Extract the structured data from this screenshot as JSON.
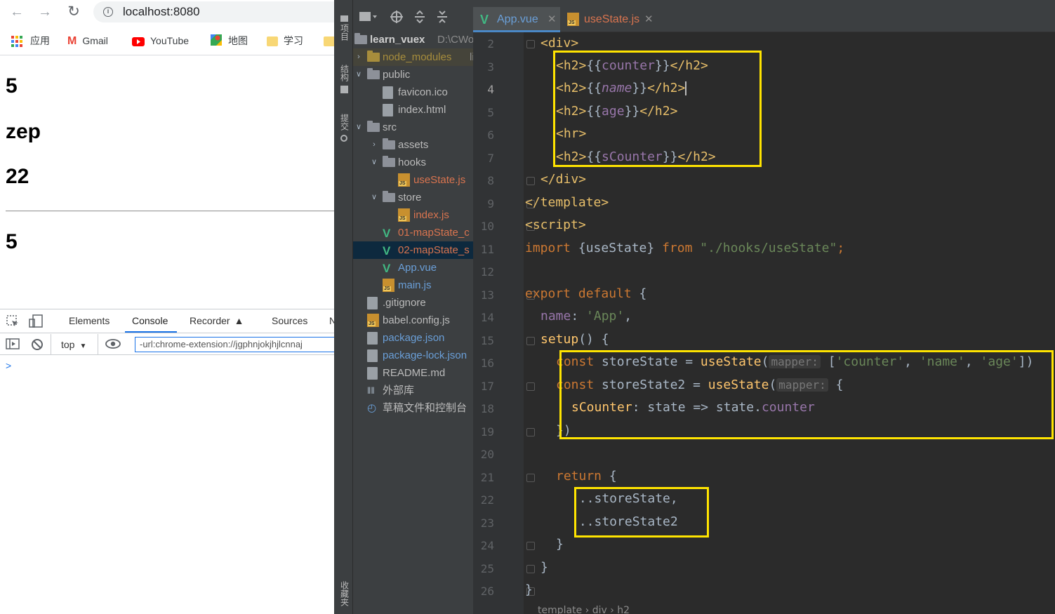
{
  "browser": {
    "url": "localhost:8080",
    "bookmarks": [
      {
        "label": "应用",
        "icon": "apps-grid-icon"
      },
      {
        "label": "Gmail",
        "icon": "gmail-icon"
      },
      {
        "label": "YouTube",
        "icon": "youtube-icon"
      },
      {
        "label": "地图",
        "icon": "maps-icon"
      },
      {
        "label": "学习",
        "icon": "folder-icon"
      }
    ],
    "page": {
      "counter": "5",
      "name": "zep",
      "age": "22",
      "sCounter": "5"
    },
    "devtools": {
      "tabs": [
        "Elements",
        "Console",
        "Recorder",
        "Sources",
        "N"
      ],
      "active_tab": "Console",
      "context": "top",
      "filter_value": "-url:chrome-extension://jgphnjokjhjlcnnaj",
      "prompt": ">"
    }
  },
  "ide": {
    "side_tool_labels": [
      "项目",
      "结构",
      "提交",
      "收藏夹"
    ],
    "project_tree": [
      {
        "label": "learn_vuex",
        "extra": "D:\\CWor",
        "depth": 0,
        "type": "root"
      },
      {
        "label": "node_modules",
        "extra": "lib",
        "depth": 0,
        "type": "folder-ylw"
      },
      {
        "label": "public",
        "depth": 0,
        "type": "folder"
      },
      {
        "label": "favicon.ico",
        "depth": 1,
        "type": "file"
      },
      {
        "label": "index.html",
        "depth": 1,
        "type": "file"
      },
      {
        "label": "src",
        "depth": 0,
        "type": "folder"
      },
      {
        "label": "assets",
        "depth": 1,
        "type": "folder"
      },
      {
        "label": "hooks",
        "depth": 1,
        "type": "folder"
      },
      {
        "label": "useState.js",
        "depth": 2,
        "type": "js-red"
      },
      {
        "label": "store",
        "depth": 1,
        "type": "folder"
      },
      {
        "label": "index.js",
        "depth": 2,
        "type": "js-red"
      },
      {
        "label": "01-mapState_c",
        "depth": 1,
        "type": "vue-red"
      },
      {
        "label": "02-mapState_s",
        "depth": 1,
        "type": "vue-red"
      },
      {
        "label": "App.vue",
        "depth": 1,
        "type": "vue-blue"
      },
      {
        "label": "main.js",
        "depth": 1,
        "type": "js-blue"
      },
      {
        "label": ".gitignore",
        "depth": 0,
        "type": "file"
      },
      {
        "label": "babel.config.js",
        "depth": 0,
        "type": "js"
      },
      {
        "label": "package.json",
        "depth": 0,
        "type": "file-blue"
      },
      {
        "label": "package-lock.json",
        "depth": 0,
        "type": "file-blue"
      },
      {
        "label": "README.md",
        "depth": 0,
        "type": "file"
      },
      {
        "label": "外部库",
        "depth": 0,
        "type": "lib"
      },
      {
        "label": "草稿文件和控制台",
        "depth": 0,
        "type": "scratch"
      }
    ],
    "tabs": [
      {
        "label": "App.vue",
        "active": true
      },
      {
        "label": "useState.js",
        "active": false
      }
    ],
    "line_numbers": [
      "2",
      "3",
      "4",
      "5",
      "6",
      "7",
      "8",
      "9",
      "10",
      "11",
      "12",
      "13",
      "14",
      "15",
      "16",
      "17",
      "18",
      "19",
      "20",
      "21",
      "22",
      "23",
      "24",
      "25",
      "26"
    ],
    "current_line": "4",
    "code": {
      "l2": "<div>",
      "l3": [
        "<h2>",
        "{{",
        "counter",
        "}}",
        "</h2>"
      ],
      "l4": [
        "<h2>",
        "{{",
        "name",
        "}}",
        "</h2>"
      ],
      "l5": [
        "<h2>",
        "{{",
        "age",
        "}}",
        "</h2>"
      ],
      "l6": "<hr>",
      "l7": [
        "<h2>",
        "{{",
        "sCounter",
        "}}",
        "</h2>"
      ],
      "l8": "</div>",
      "l9": "</template>",
      "l10": "<script>",
      "l11": [
        "import ",
        "{useState}",
        " from ",
        "\"./hooks/useState\"",
        ";"
      ],
      "l13": [
        "export default",
        " {"
      ],
      "l14": [
        "name",
        ": ",
        "'App'",
        ","
      ],
      "l15": [
        "setup",
        "() {"
      ],
      "l16": [
        "const ",
        "storeState = ",
        "useState",
        "(",
        "mapper:",
        " [",
        "'counter'",
        ", ",
        "'name'",
        ", ",
        "'age'",
        "])"
      ],
      "l17": [
        "const ",
        "storeState2 = ",
        "useState",
        "(",
        "mapper:",
        " {"
      ],
      "l18": [
        "sCounter",
        ": state => state.",
        "counter"
      ],
      "l19": "})",
      "l21": [
        "return",
        " {"
      ],
      "l22": "...storeState,",
      "l23": "...storeState2",
      "l24": "}",
      "l25": "}",
      "l26": "}"
    },
    "breadcrumb": "template  ›  div  ›  h2"
  },
  "colors": {
    "highlight_box": "#ffe400",
    "ide_bg": "#2b2b2b",
    "tag": "#e8bf6a",
    "keyword": "#cc7832",
    "string": "#6a8759"
  }
}
